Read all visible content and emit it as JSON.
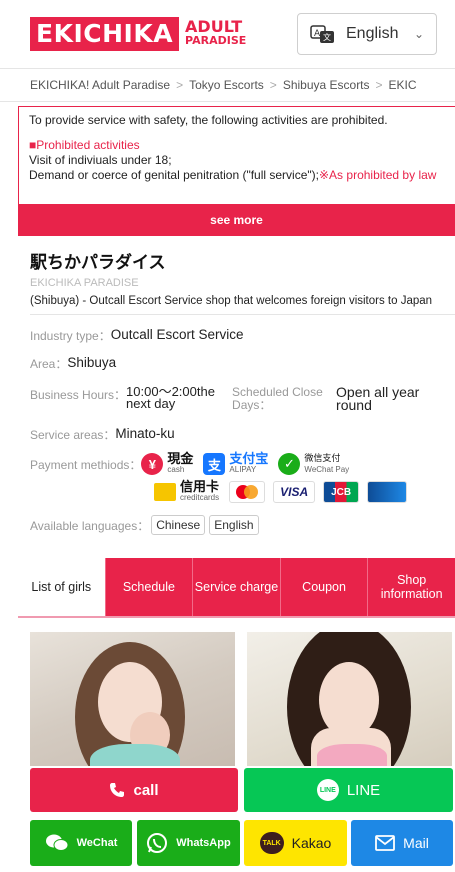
{
  "header": {
    "logo_main": "EKICHIKA",
    "logo_sub1": "ADULT",
    "logo_sub2": "PARADISE",
    "language": "English"
  },
  "breadcrumb": [
    "EKICHIKA! Adult Paradise",
    "Tokyo Escorts",
    "Shibuya Escorts",
    "EKIC"
  ],
  "notice": {
    "intro": "To provide service with safety, the following activities are prohibited.",
    "heading": "■Prohibited activities",
    "line1": "Visit of indiviuals under 18;",
    "line2": "Demand or coerce of genital penitration (\"full service\");",
    "line2_red": "※As prohibited by law",
    "see_more": "see more"
  },
  "shop": {
    "name": "駅ちかパラダイス",
    "name_en": "EKICHIKA PARADISE",
    "description": "(Shibuya) - Outcall Escort Service shop that welcomes foreign visitors to Japan"
  },
  "info": {
    "industry_label": "Industry type：",
    "industry_value": "Outcall Escort Service",
    "area_label": "Area：",
    "area_value": "Shibuya",
    "hours_label": "Business Hours：",
    "hours_value": "10:00～2:00the next day",
    "close_label": "Scheduled Close Days：",
    "close_value": "Open all year round",
    "service_label": "Service areas：",
    "service_value": "Minato-ku",
    "payment_label": "Payment methiods：",
    "payments": {
      "cash": "現金",
      "cash_sub": "cash",
      "alipay": "支付宝",
      "alipay_sub": "ALIPAY",
      "wechat": "微信支付",
      "wechat_sub": "WeChat Pay",
      "credit": "信用卡",
      "credit_sub": "creditcards",
      "visa": "VISA",
      "jcb": "JCB"
    },
    "languages_label": "Available languages：",
    "languages": [
      "Chinese",
      "English"
    ]
  },
  "tabs": [
    "List of girls",
    "Schedule",
    "Service charge",
    "Coupon",
    "Shop information"
  ],
  "buttons": {
    "call": "call",
    "line": "LINE",
    "wechat": "WeChat",
    "whatsapp": "WhatsApp",
    "kakao": "Kakao",
    "mail": "Mail"
  },
  "colors": {
    "accent": "#e8234a",
    "line_green": "#06c755",
    "wechat_green": "#1aad19",
    "kakao_yellow": "#fee500",
    "mail_blue": "#1e88e5"
  }
}
